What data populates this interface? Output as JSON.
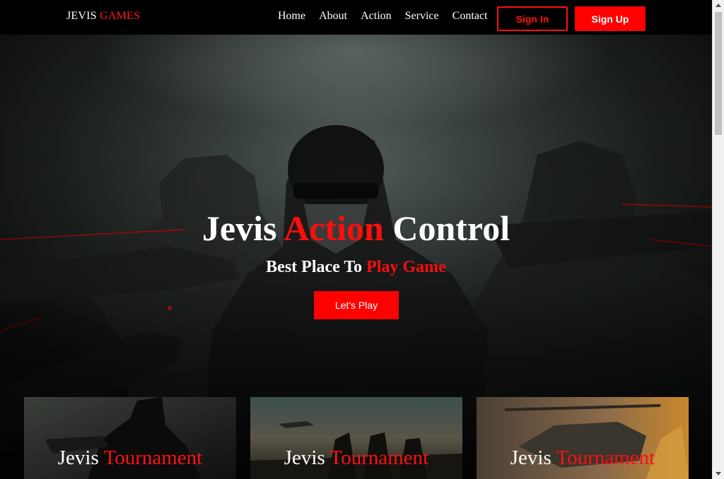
{
  "navbar": {
    "brand": {
      "first": "JEVIS",
      "accent": "GAMES"
    },
    "links": [
      "Home",
      "About",
      "Action",
      "Service",
      "Contact"
    ],
    "sign_in_label": "Sign In",
    "sign_up_label": "Sign Up"
  },
  "hero": {
    "title": {
      "first": "Jevis",
      "accent": "Action",
      "last": "Control"
    },
    "subtitle": {
      "first": "Best Place To",
      "accent": "Play Game"
    },
    "cta_label": "Let's Play"
  },
  "cards": [
    {
      "first": "Jevis",
      "accent": "Tournament"
    },
    {
      "first": "Jevis",
      "accent": "Tournament"
    },
    {
      "first": "Jevis",
      "accent": "Tournament"
    }
  ],
  "colors": {
    "accent": "#ff0000",
    "navbar_bg": "#000000",
    "text": "#ffffff"
  }
}
